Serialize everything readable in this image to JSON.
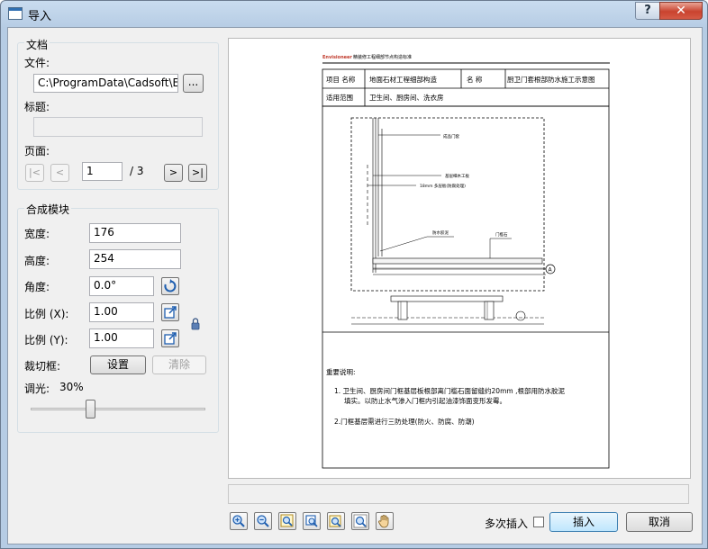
{
  "window": {
    "title": "导入",
    "help_label": "?",
    "close_label": "✕"
  },
  "document": {
    "group_label": "文档",
    "file_label": "文件:",
    "file_value": "C:\\ProgramData\\Cadsoft\\Envisio",
    "browse_label": "...",
    "title_label": "标题:",
    "title_value": "",
    "page_label": "页面:",
    "page_value": "1",
    "page_total": "/ 3",
    "first_label": "|<",
    "prev_label": "<",
    "next_label": ">",
    "last_label": ">|"
  },
  "block": {
    "group_label": "合成模块",
    "width_label": "宽度:",
    "width_value": "176",
    "height_label": "高度:",
    "height_value": "254",
    "angle_label": "角度:",
    "angle_value": "0.0°",
    "scale_x_label": "比例 (X):",
    "scale_x_value": "1.00",
    "scale_y_label": "比例 (Y):",
    "scale_y_value": "1.00",
    "clip_label": "裁切框:",
    "set_label": "设置",
    "clear_label": "清除",
    "dimming_label": "调光:",
    "dimming_value": "30%",
    "dimming_fraction": 0.3
  },
  "preview": {
    "header_brand": "Envisioneer",
    "header_title": "精装修工程细部节点构造标准",
    "row1_label": "项目 名称",
    "row1_value": "地面石材工程细部构造",
    "row1_name_label": "名 称",
    "row1_name_value": "厨卫门套根部防水施工示意图",
    "row2_label": "适用范围",
    "row2_value": "卫生间、厨房间、洗衣房",
    "ann1": "成品门套",
    "ann2": "基层细木工板",
    "ann3": "18mm 多层板(防腐处理)",
    "ann4": "防水胶泥",
    "ann5": "门槛石",
    "marker": "A",
    "notes_title": "重要说明:",
    "note1_line1": "1. 卫生间、厨房间门框基层板根部离门槛石面留缝约20mm ,根部用防水胶泥",
    "note1_line2": "填实。以防止水气渗入门框内引起油漆饰面变形发霉。",
    "note2": "2.门框基层需进行三防处理(防火、防腐、防潮)"
  },
  "footer": {
    "multi_insert_label": "多次插入",
    "insert_label": "插入",
    "cancel_label": "取消"
  }
}
